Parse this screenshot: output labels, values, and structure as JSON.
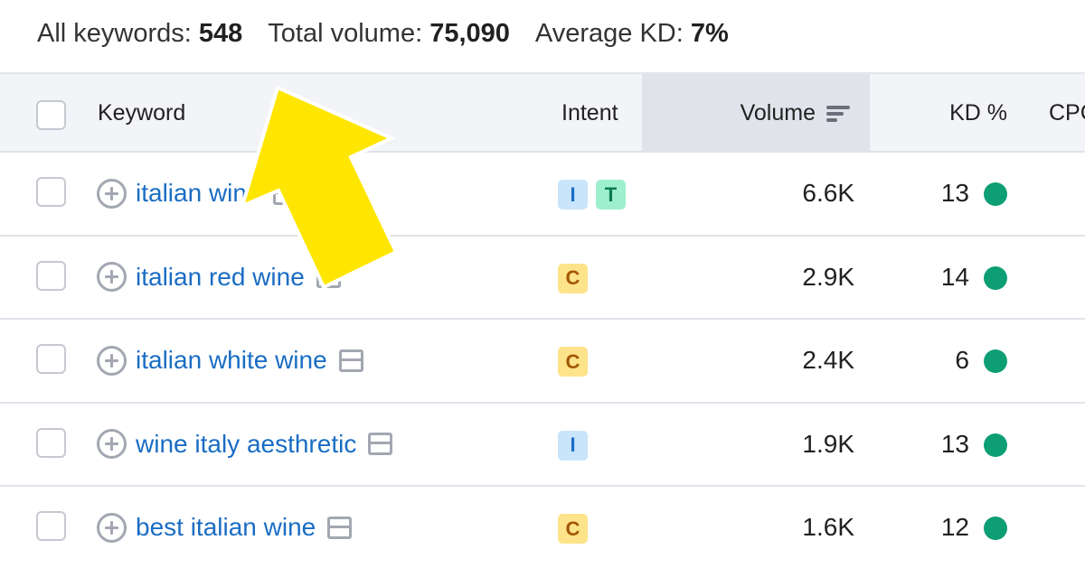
{
  "summary": {
    "all_keywords_label": "All keywords:",
    "all_keywords_value": "548",
    "total_volume_label": "Total volume:",
    "total_volume_value": "75,090",
    "average_kd_label": "Average KD:",
    "average_kd_value": "7%"
  },
  "columns": {
    "keyword": "Keyword",
    "intent": "Intent",
    "volume": "Volume",
    "kd": "KD %",
    "cpc": "CPC"
  },
  "intent_styles": {
    "I": {
      "bg": "#c9e5fb",
      "fg": "#1a6dc4"
    },
    "T": {
      "bg": "#9ef0cd",
      "fg": "#0e7a52"
    },
    "C": {
      "bg": "#fde38a",
      "fg": "#a45700"
    }
  },
  "kd_dot_color": "#0d9e74",
  "highlight_arrow_color": "#ffe600",
  "rows": [
    {
      "keyword": "italian wine",
      "intents": [
        "I",
        "T"
      ],
      "volume": "6.6K",
      "kd": "13"
    },
    {
      "keyword": "italian red wine",
      "intents": [
        "C"
      ],
      "volume": "2.9K",
      "kd": "14"
    },
    {
      "keyword": "italian white wine",
      "intents": [
        "C"
      ],
      "volume": "2.4K",
      "kd": "6"
    },
    {
      "keyword": "wine italy aesthretic",
      "intents": [
        "I"
      ],
      "volume": "1.9K",
      "kd": "13"
    },
    {
      "keyword": "best italian wine",
      "intents": [
        "C"
      ],
      "volume": "1.6K",
      "kd": "12"
    }
  ]
}
